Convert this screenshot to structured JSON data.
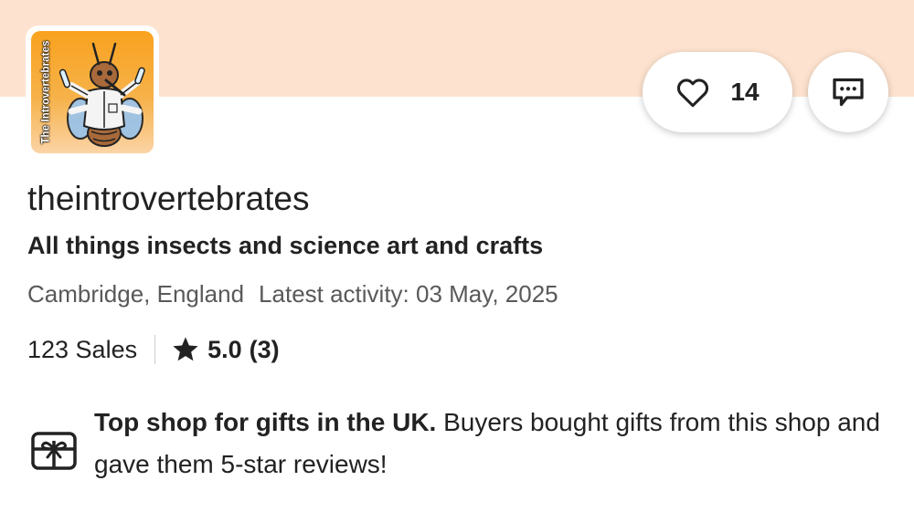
{
  "shop": {
    "logo_text": "The Introvertebrates",
    "name": "theintrovertebrates",
    "tagline": "All things insects and science art and crafts",
    "location": "Cambridge, England",
    "latest_activity": "Latest activity: 03 May, 2025"
  },
  "actions": {
    "favorite_count": "14",
    "favorite_icon": "heart-icon",
    "contact_icon": "message-icon"
  },
  "stats": {
    "sales": "123 Sales",
    "rating": "5.0",
    "review_count": "(3)",
    "rating_icon": "star-icon"
  },
  "badge": {
    "icon": "gift-icon",
    "title": "Top shop for gifts in the UK.",
    "description": " Buyers bought gifts from this shop and gave them 5-star reviews!"
  },
  "colors": {
    "banner": "#fde3cf",
    "text": "#222222",
    "muted_text": "#595959",
    "logo_background": "#f9a21f"
  }
}
